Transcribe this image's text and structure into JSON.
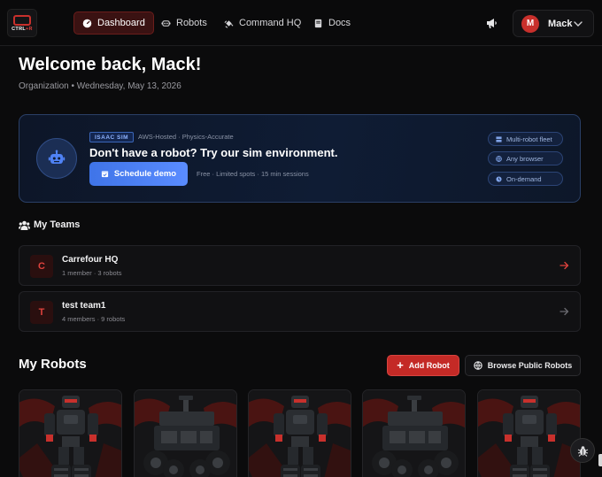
{
  "brand": {
    "logo_prefix": "CTRL",
    "logo_suffix": "+R"
  },
  "nav": {
    "items": [
      {
        "label": "Dashboard",
        "icon": "gauge-icon",
        "active": true
      },
      {
        "label": "Robots",
        "icon": "robot-icon"
      },
      {
        "label": "Command HQ",
        "icon": "satellite-icon"
      },
      {
        "label": "Docs",
        "icon": "book-icon"
      }
    ],
    "announcements_icon": "megaphone-icon"
  },
  "user": {
    "initial": "M",
    "name": "Mack"
  },
  "header": {
    "welcome": "Welcome back, Mack!",
    "subline": "Organization • Wednesday, May 13, 2026"
  },
  "sim_banner": {
    "chip": "ISAAC SIM",
    "meta": "AWS-Hosted · Physics-Accurate",
    "title": "Don't have a robot? Try our sim environment.",
    "button": "Schedule demo",
    "button_meta": "Free · Limited spots · 15 min sessions",
    "features": [
      "Multi-robot fleet",
      "Any browser",
      "On-demand"
    ]
  },
  "teams": {
    "title": "My Teams",
    "items": [
      {
        "initial": "C",
        "name": "Carrefour HQ",
        "meta": "1 member · 3 robots",
        "arrow_color": "#e0423d"
      },
      {
        "initial": "T",
        "name": "test team1",
        "meta": "4 members · 9 robots",
        "arrow_color": "#6a6a70"
      }
    ]
  },
  "robots": {
    "title": "My Robots",
    "add_button": "Add Robot",
    "browse_button": "Browse Public Robots",
    "cards": [
      {
        "kind": "humanoid-tracked"
      },
      {
        "kind": "rover-4wheel"
      },
      {
        "kind": "humanoid-tracked"
      },
      {
        "kind": "rover-4wheel"
      },
      {
        "kind": "humanoid-tracked"
      }
    ]
  },
  "colors": {
    "accent_red": "#c42a26",
    "accent_blue": "#4f82f5",
    "bg": "#0b0b0c"
  }
}
